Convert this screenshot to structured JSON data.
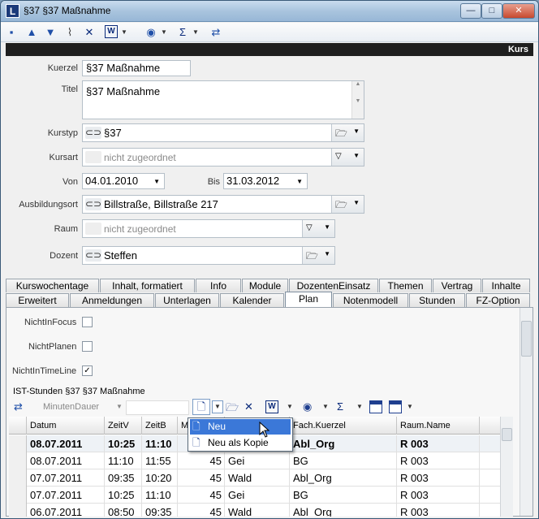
{
  "window": {
    "title": "§37 §37 Maßnahme"
  },
  "header": {
    "right_label": "Kurs"
  },
  "form": {
    "kuerzel_label": "Kuerzel",
    "kuerzel_value": "§37 Maßnahme",
    "titel_label": "Titel",
    "titel_value": "§37 Maßnahme",
    "kurstyp_label": "Kurstyp",
    "kurstyp_value": "§37",
    "kursart_label": "Kursart",
    "kursart_value": "nicht zugeordnet",
    "von_label": "Von",
    "von_value": "04.01.2010",
    "bis_label": "Bis",
    "bis_value": "31.03.2012",
    "ausbildungsort_label": "Ausbildungsort",
    "ausbildungsort_value": "Billstraße, Billstraße 217",
    "raum_label": "Raum",
    "raum_value": "nicht zugeordnet",
    "dozent_label": "Dozent",
    "dozent_value": "Steffen"
  },
  "tabs_top": [
    "Kurswochentage",
    "Inhalt, formatiert",
    "Info",
    "Module",
    "DozentenEinsatz",
    "Themen",
    "Vertrag",
    "Inhalte"
  ],
  "tabs_bottom": [
    "Erweitert",
    "Anmeldungen",
    "Unterlagen",
    "Kalender",
    "Plan",
    "Notenmodell",
    "Stunden",
    "FZ-Option"
  ],
  "active_tab": "Plan",
  "plan": {
    "nichtinfocus_label": "NichtInFocus",
    "nichtinfocus_checked": false,
    "nichtplanen_label": "NichtPlanen",
    "nichtplanen_checked": false,
    "nichtintimeline_label": "NichtInTimeLine",
    "nichtintimeline_checked": true,
    "section_title": "IST-Stunden §37 §37 Maßnahme",
    "minutendauer_label": "MinutenDauer"
  },
  "grid": {
    "columns": [
      "Datum",
      "ZeitV",
      "ZeitB",
      "M",
      "",
      "Fach.Kuerzel",
      "Raum.Name"
    ],
    "rows": [
      {
        "datum": "08.07.2011",
        "zeitv": "10:25",
        "zeitb": "11:10",
        "m": "",
        "doz": "",
        "fach": "Abl_Org",
        "raum": "R 003"
      },
      {
        "datum": "08.07.2011",
        "zeitv": "11:10",
        "zeitb": "11:55",
        "m": "45",
        "doz": "Gei",
        "fach": "BG",
        "raum": "R 003"
      },
      {
        "datum": "07.07.2011",
        "zeitv": "09:35",
        "zeitb": "10:20",
        "m": "45",
        "doz": "Wald",
        "fach": "Abl_Org",
        "raum": "R 003"
      },
      {
        "datum": "07.07.2011",
        "zeitv": "10:25",
        "zeitb": "11:10",
        "m": "45",
        "doz": "Gei",
        "fach": "BG",
        "raum": "R 003"
      },
      {
        "datum": "06.07.2011",
        "zeitv": "08:50",
        "zeitb": "09:35",
        "m": "45",
        "doz": "Wald",
        "fach": "Abl_Org",
        "raum": "R 003"
      }
    ]
  },
  "context_menu": {
    "items": [
      "Neu",
      "Neu als Kopie"
    ]
  }
}
